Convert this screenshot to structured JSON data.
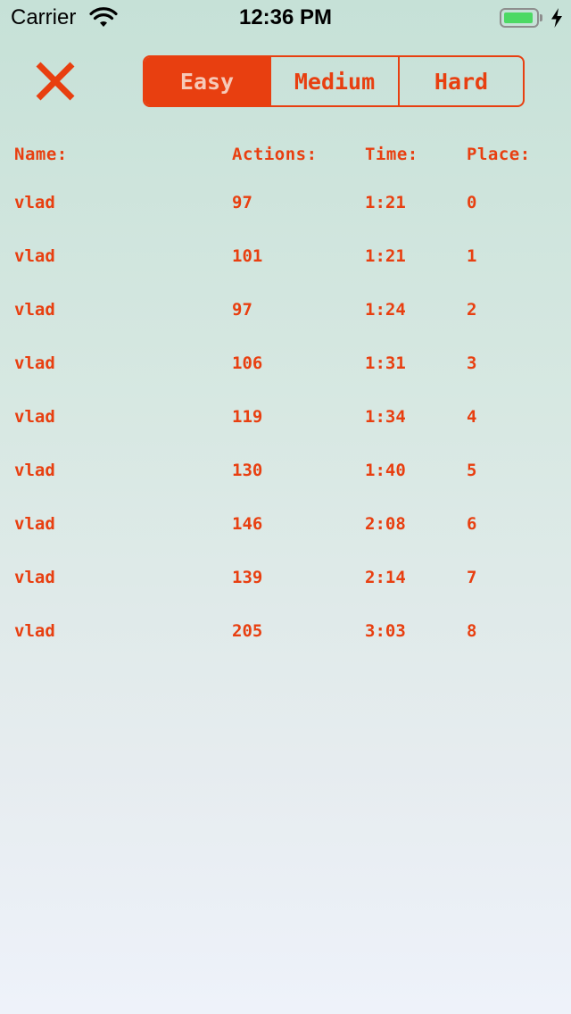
{
  "status_bar": {
    "carrier": "Carrier",
    "time": "12:36 PM",
    "battery_level": 0.95,
    "charging": true
  },
  "colors": {
    "accent": "#e83f10",
    "selected_text": "#f6c9b8",
    "battery_fill": "#4cd964"
  },
  "close_icon": "close-icon",
  "difficulty": {
    "selected": "Easy",
    "options": [
      "Easy",
      "Medium",
      "Hard"
    ]
  },
  "table": {
    "headers": {
      "name": "Name:",
      "actions": "Actions:",
      "time": "Time:",
      "place": "Place:"
    },
    "rows": [
      {
        "name": "vlad",
        "actions": "97",
        "time": "1:21",
        "place": "0"
      },
      {
        "name": "vlad",
        "actions": "101",
        "time": "1:21",
        "place": "1"
      },
      {
        "name": "vlad",
        "actions": "97",
        "time": "1:24",
        "place": "2"
      },
      {
        "name": "vlad",
        "actions": "106",
        "time": "1:31",
        "place": "3"
      },
      {
        "name": "vlad",
        "actions": "119",
        "time": "1:34",
        "place": "4"
      },
      {
        "name": "vlad",
        "actions": "130",
        "time": "1:40",
        "place": "5"
      },
      {
        "name": "vlad",
        "actions": "146",
        "time": "2:08",
        "place": "6"
      },
      {
        "name": "vlad",
        "actions": "139",
        "time": "2:14",
        "place": "7"
      },
      {
        "name": "vlad",
        "actions": "205",
        "time": "3:03",
        "place": "8"
      }
    ]
  }
}
